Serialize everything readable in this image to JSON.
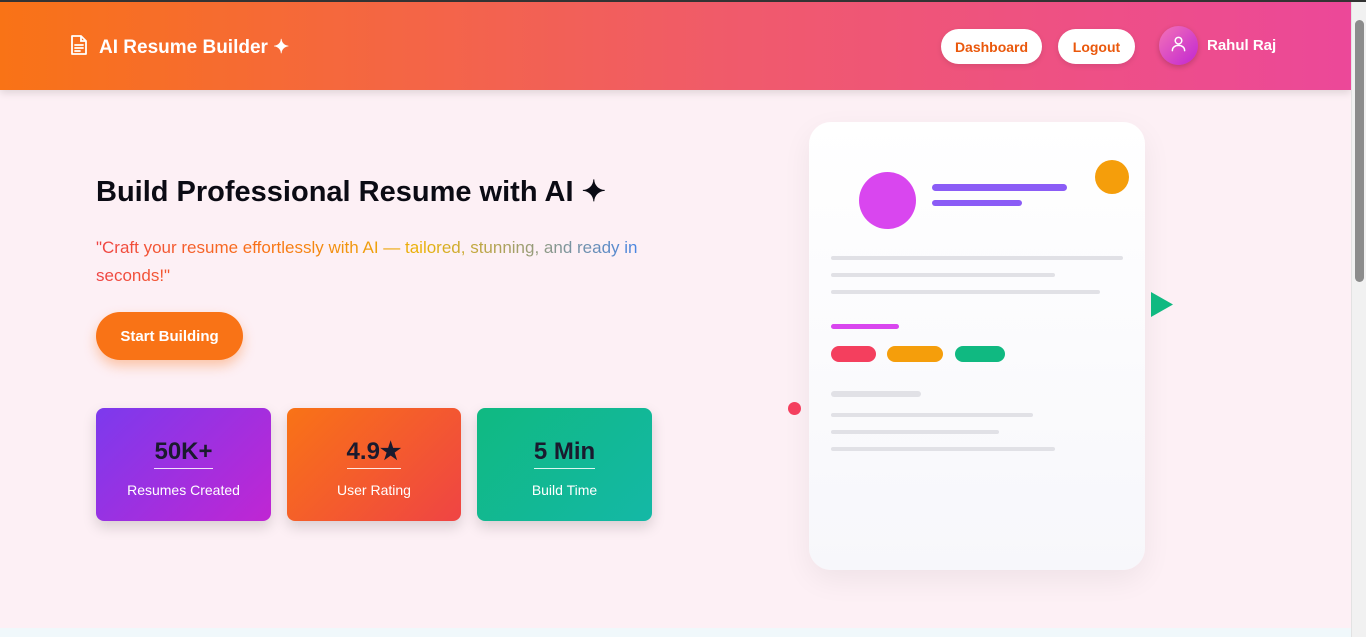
{
  "header": {
    "brand": "AI Resume Builder ✦",
    "nav": {
      "dashboard": "Dashboard",
      "logout": "Logout"
    },
    "user_name": "Rahul Raj"
  },
  "hero": {
    "title": "Build Professional Resume with AI ✦",
    "subtitle": "\"Craft your resume effortlessly with AI — tailored, stunning, and ready in seconds!\"",
    "cta": "Start Building"
  },
  "stats": [
    {
      "value": "50K+",
      "label": "Resumes Created"
    },
    {
      "value": "4.9★",
      "label": "User Rating"
    },
    {
      "value": "5 Min",
      "label": "Build Time"
    }
  ],
  "colors": {
    "orange": "#f97316",
    "pink": "#ec4899",
    "purple": "#7c3aed",
    "green": "#10b981",
    "magenta": "#d946ef",
    "amber": "#f59e0b",
    "red": "#f43f5e"
  }
}
